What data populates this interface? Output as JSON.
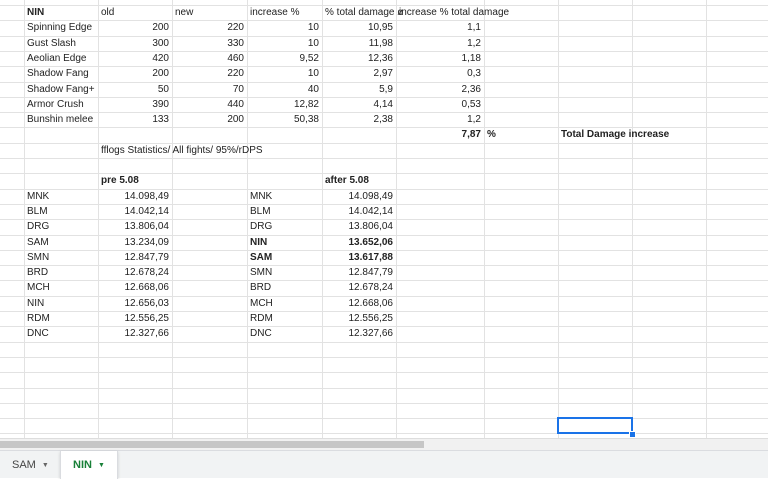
{
  "table1": {
    "headers": [
      "NIN",
      "old",
      "new",
      "increase %",
      "% total damage ø",
      "increase % total damage"
    ],
    "rows": [
      [
        "Spinning Edge",
        "200",
        "220",
        "10",
        "10,95",
        "1,1"
      ],
      [
        "Gust Slash",
        "300",
        "330",
        "10",
        "11,98",
        "1,2"
      ],
      [
        "Aeolian Edge",
        "420",
        "460",
        "9,52",
        "12,36",
        "1,18"
      ],
      [
        "Shadow Fang",
        "200",
        "220",
        "10",
        "2,97",
        "0,3"
      ],
      [
        "Shadow Fang+",
        "50",
        "70",
        "40",
        "5,9",
        "2,36"
      ],
      [
        "Armor Crush",
        "390",
        "440",
        "12,82",
        "4,14",
        "0,53"
      ],
      [
        "Bunshin melee",
        "133",
        "200",
        "50,38",
        "2,38",
        "1,2"
      ]
    ],
    "total_value": "7,87",
    "total_unit": "%",
    "total_label": "Total Damage increase"
  },
  "stats_caption": "fflogs Statistics/ All fights/ 95%/rDPS",
  "pre": {
    "title": "pre 5.08",
    "rows": [
      [
        "MNK",
        "14.098,49"
      ],
      [
        "BLM",
        "14.042,14"
      ],
      [
        "DRG",
        "13.806,04"
      ],
      [
        "SAM",
        "13.234,09"
      ],
      [
        "SMN",
        "12.847,79"
      ],
      [
        "BRD",
        "12.678,24"
      ],
      [
        "MCH",
        "12.668,06"
      ],
      [
        "NIN",
        "12.656,03"
      ],
      [
        "RDM",
        "12.556,25"
      ],
      [
        "DNC",
        "12.327,66"
      ]
    ]
  },
  "after": {
    "title": "after 5.08",
    "rows": [
      [
        "MNK",
        "14.098,49"
      ],
      [
        "BLM",
        "14.042,14"
      ],
      [
        "DRG",
        "13.806,04"
      ],
      [
        "NIN",
        "13.652,06"
      ],
      [
        "SAM",
        "13.617,88"
      ],
      [
        "SMN",
        "12.847,79"
      ],
      [
        "BRD",
        "12.678,24"
      ],
      [
        "MCH",
        "12.668,06"
      ],
      [
        "RDM",
        "12.556,25"
      ],
      [
        "DNC",
        "12.327,66"
      ]
    ],
    "bold_rows": [
      3,
      4
    ]
  },
  "sheet_tabs": [
    {
      "label": "SAM",
      "active": false
    },
    {
      "label": "NIN",
      "active": true
    }
  ],
  "colors": {
    "active_tab": "#188038",
    "selection": "#1a73e8",
    "gridline": "#e2e2e2"
  }
}
